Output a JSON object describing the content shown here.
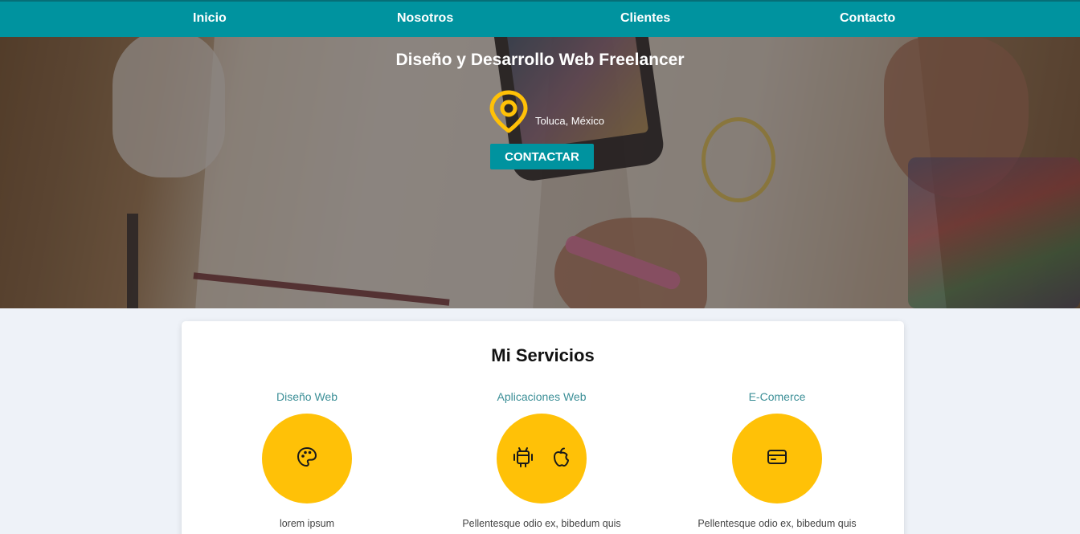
{
  "nav": {
    "items": [
      {
        "label": "Inicio"
      },
      {
        "label": "Nosotros"
      },
      {
        "label": "Clientes"
      },
      {
        "label": "Contacto"
      }
    ]
  },
  "hero": {
    "title": "Diseño y Desarrollo Web Freelancer",
    "location": "Toluca, México",
    "location_icon": "map-pin-icon",
    "cta_label": "CONTACTAR"
  },
  "services": {
    "title": "Mi Servicios",
    "items": [
      {
        "label": "Diseño Web",
        "icons": [
          "palette-icon"
        ],
        "description": "lorem ipsum"
      },
      {
        "label": "Aplicaciones Web",
        "icons": [
          "android-icon",
          "apple-icon"
        ],
        "description": "Pellentesque odio ex, bibedum quis"
      },
      {
        "label": "E-Comerce",
        "icons": [
          "credit-card-icon"
        ],
        "description": "Pellentesque odio ex, bibedum quis"
      }
    ]
  },
  "colors": {
    "primary": "#00939f",
    "accent": "#ffc107",
    "service_label": "#3c8f97",
    "background": "#eef2f8"
  }
}
